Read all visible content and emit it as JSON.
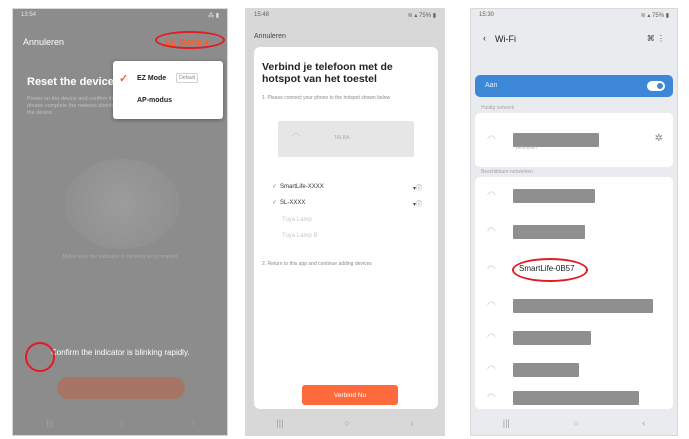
{
  "colors": {
    "accent_orange": "#ff6a3d",
    "highlight_red": "#e31b23",
    "wifi_blue": "#3d88d6"
  },
  "phone1": {
    "status_time": "13:54",
    "status_icons": "⁂ ▮",
    "cancel_label": "Annuleren",
    "mode_label": "EZ Mode",
    "mode_arrow": "▾",
    "title": "Reset the device",
    "description": "Power on the device and confirm the indicator is blinking rapidly. Note: please complete the network distribution within 3 minutes after resetting the device.",
    "caption": "Make sure the indicator is blinking as prompted",
    "confirm_text": "Confirm the indicator is blinking rapidly.",
    "menu": {
      "option_ez": "EZ Mode",
      "default_badge": "Default",
      "option_ap": "AP-modus",
      "checkmark_icon": "✓"
    },
    "nav": [
      "|||",
      "○",
      "‹"
    ]
  },
  "phone2": {
    "status_time": "15:48",
    "status_icons": "≋ ▴ 75% ▮",
    "cancel_label": "Annuleren",
    "title": "Verbind je telefoon met de hotspot van het toestel",
    "step1": "1. Please connect your phone to the hotspot shown below",
    "hotspot_name": "TALBA",
    "networks": [
      {
        "name": "SmartLife-XXXX",
        "faint": false
      },
      {
        "name": "SL-XXXX",
        "faint": false
      },
      {
        "name": "Tuya Lamp",
        "faint": true
      },
      {
        "name": "Tuya Lamp B",
        "faint": true
      }
    ],
    "signal_icon": "▾ⓘ",
    "tick_icon": "✓",
    "step2": "2. Return to this app and continue adding devices",
    "cta_label": "Verbind Nu",
    "nav": [
      "|||",
      "○",
      "‹"
    ]
  },
  "phone3": {
    "status_time": "15:30",
    "status_icons": "≋ ▴ 75% ▮",
    "back_icon": "‹",
    "title": "Wi-Fi",
    "actions": "⌘ ⋮",
    "on_label": "Aan",
    "current_network_label": "Huidig netwerk",
    "current_network_sub": "Verbonden",
    "available_label": "Beschikbare netwerken",
    "highlighted_ssid": "SmartLife-0B57",
    "wifi_icon": "◠",
    "gear_icon": "✲",
    "nav": [
      "|||",
      "○",
      "‹"
    ]
  }
}
